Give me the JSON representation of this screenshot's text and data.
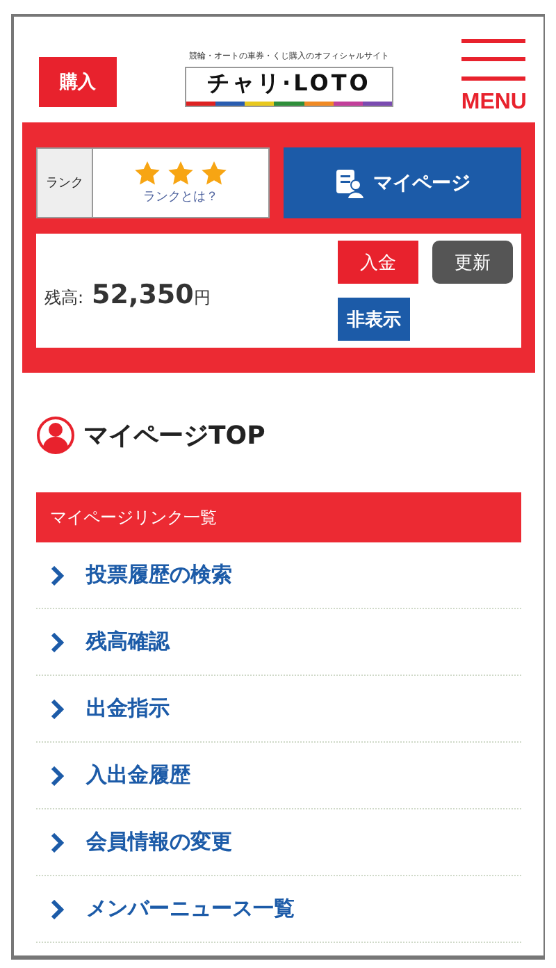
{
  "header": {
    "buy_button": "購入",
    "tagline": "競輪・オートの車券・くじ購入のオフィシャルサイト",
    "logo": "チャリ·LOTO",
    "menu_label": "MENU"
  },
  "account": {
    "rank_label": "ランク",
    "stars": 3,
    "rank_link": "ランクとは？",
    "mypage_button": "マイページ",
    "balance_label": "残高:",
    "balance_value": "52,350",
    "balance_unit": "円",
    "deposit_button": "入金",
    "refresh_button": "更新",
    "hide_button": "非表示"
  },
  "page_title": "マイページTOP",
  "links_heading": "マイページリンク一覧",
  "links": [
    "投票履歴の検索",
    "残高確認",
    "出金指示",
    "入出金履歴",
    "会員情報の変更",
    "メンバーニュース一覧"
  ]
}
